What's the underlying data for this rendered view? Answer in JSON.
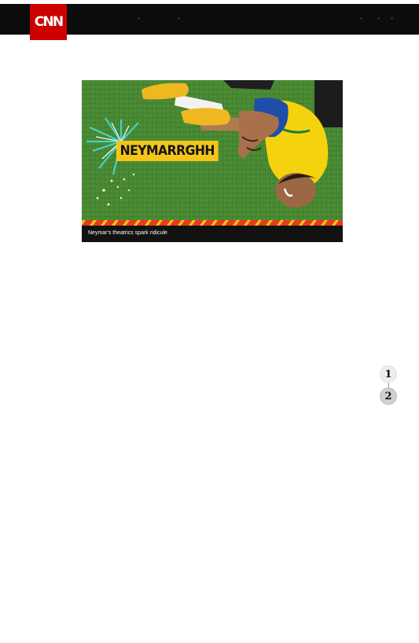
{
  "header": {
    "logo_text": "CNN",
    "logo_color": "#cc0000",
    "bar_color": "#0c0c0c"
  },
  "feature": {
    "title": "NEYMARRGHH",
    "caption": "Neymar's theatrics spark ridicule",
    "accent_color": "#f4c61a",
    "stripe_colors": [
      "#e83a1c",
      "#f4c61a"
    ]
  },
  "pager": {
    "pages": [
      "1",
      "2"
    ],
    "current": "2"
  }
}
